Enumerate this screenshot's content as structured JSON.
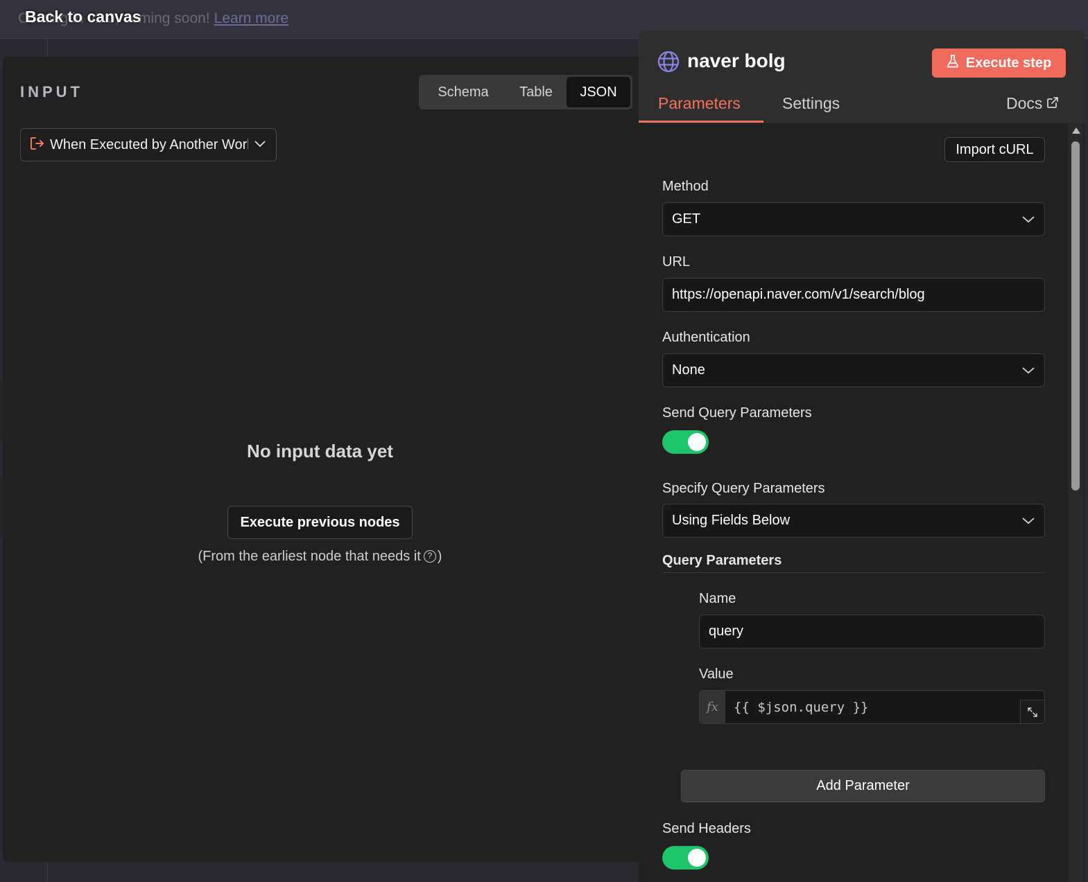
{
  "banner": {
    "text": "Coming in v2.0, coming soon!",
    "link": "Learn more",
    "back_label": "Back to canvas"
  },
  "input_panel": {
    "title": "INPUT",
    "views": [
      "Schema",
      "Table",
      "JSON"
    ],
    "active_view": "JSON",
    "trigger_select": "When Executed by Another Workflow",
    "empty_title": "No input data yet",
    "execute_previous_label": "Execute previous nodes",
    "from_note_prefix": "(From the earliest node that needs it",
    "from_note_suffix": ")"
  },
  "node": {
    "title": "naver bolg",
    "execute_label": "Execute step",
    "tabs": [
      "Parameters",
      "Settings"
    ],
    "active_tab": "Parameters",
    "docs_label": "Docs"
  },
  "params": {
    "import_curl_label": "Import cURL",
    "method_label": "Method",
    "method_value": "GET",
    "url_label": "URL",
    "url_value": "https://openapi.naver.com/v1/search/blog",
    "auth_label": "Authentication",
    "auth_value": "None",
    "send_query_label": "Send Query Parameters",
    "send_query_on": true,
    "specify_query_label": "Specify Query Parameters",
    "specify_query_value": "Using Fields Below",
    "query_params_label": "Query Parameters",
    "name_label": "Name",
    "name_value": "query",
    "value_label": "Value",
    "value_value": "{{ $json.query }}",
    "fx_label": "fx",
    "add_param_label": "Add Parameter",
    "send_headers_label": "Send Headers",
    "send_headers_on": true
  },
  "colors": {
    "accent": "#f2715f",
    "execute_button": "#f06b5b",
    "toggle_on": "#1ec46a",
    "globe_icon": "#8b86e6"
  }
}
